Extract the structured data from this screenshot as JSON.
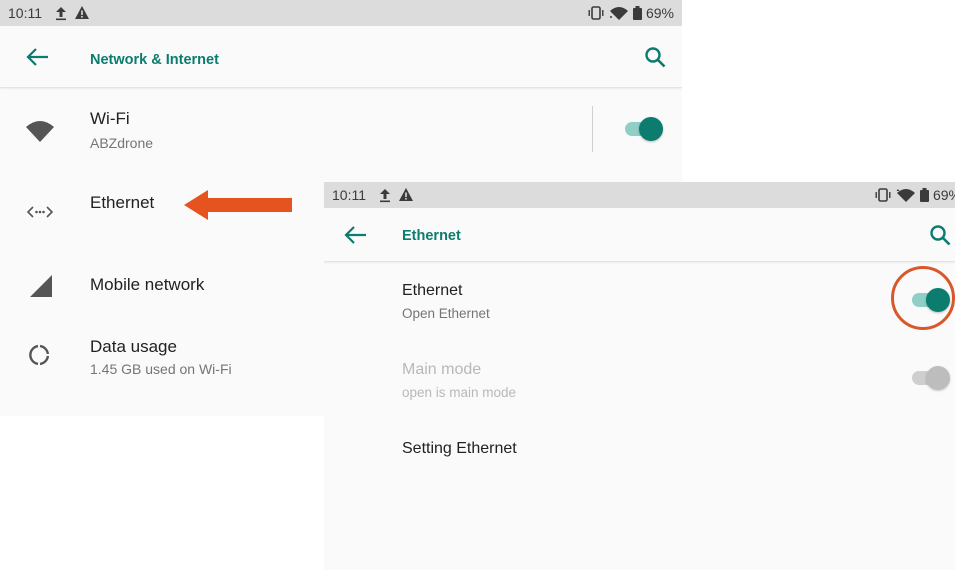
{
  "screen1": {
    "status": {
      "time": "10:11",
      "battery": "69%"
    },
    "appbar": {
      "title": "Network & Internet"
    },
    "items": [
      {
        "label": "Wi-Fi",
        "sub": "ABZdrone",
        "icon": "wifi-icon",
        "toggle": "on"
      },
      {
        "label": "Ethernet",
        "icon": "ethernet-icon"
      },
      {
        "label": "Mobile network",
        "icon": "signal-icon"
      },
      {
        "label": "Data usage",
        "sub": "1.45 GB used on Wi-Fi",
        "icon": "data-usage-icon"
      }
    ]
  },
  "screen2": {
    "status": {
      "time": "10:11",
      "battery": "69%"
    },
    "appbar": {
      "title": "Ethernet"
    },
    "items": [
      {
        "label": "Ethernet",
        "sub": "Open Ethernet",
        "toggle": "on",
        "enabled": true
      },
      {
        "label": "Main mode",
        "sub": "open is main mode",
        "toggle": "on",
        "enabled": false
      },
      {
        "label": "Setting Ethernet"
      }
    ]
  },
  "annotations": {
    "arrow_color": "#e5531f",
    "circle_color": "#d9582b"
  },
  "colors": {
    "accent": "#0b7c6e",
    "statusbar": "#dcdcdc",
    "background": "#fafafa"
  }
}
